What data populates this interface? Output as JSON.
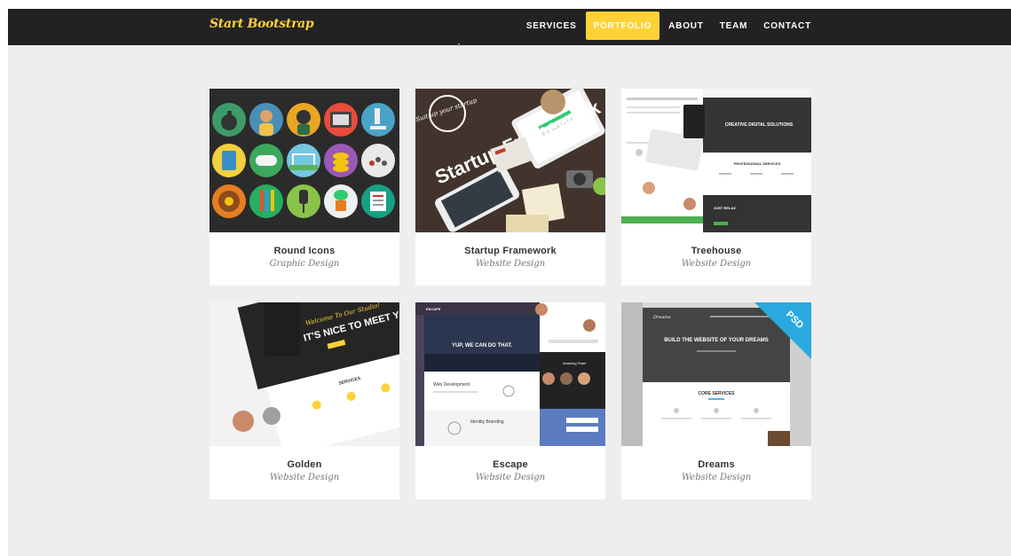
{
  "brand": "Start Bootstrap",
  "nav": {
    "items": [
      "Services",
      "Portfolio",
      "About",
      "Team",
      "Contact"
    ],
    "active": "Portfolio"
  },
  "portfolio": {
    "items": [
      {
        "title": "Round Icons",
        "category": "Graphic Design"
      },
      {
        "title": "Startup Framework",
        "category": "Website Design"
      },
      {
        "title": "Treehouse",
        "category": "Website Design"
      },
      {
        "title": "Golden",
        "category": "Website Design"
      },
      {
        "title": "Escape",
        "category": "Website Design"
      },
      {
        "title": "Dreams",
        "category": "Website Design"
      }
    ]
  },
  "thumbs": {
    "startup": {
      "badge": "Suit up your startup",
      "headline": "Startup Framework"
    },
    "treehouse": {
      "hero": "CREATIVE DIGITAL SOLUTIONS",
      "services": "PROFESSIONAL SERVICES",
      "cta": "JUST RELAX"
    },
    "golden": {
      "welcome": "Welcome To Our Studio!",
      "headline": "IT'S NICE TO MEET YOU",
      "services": "SERVICES"
    },
    "escape": {
      "brand": "ESCAPE",
      "headline": "YUP, WE CAN DO THAT.",
      "team": "Amazing Team",
      "web": "Web Development",
      "identity": "Identity Branding"
    },
    "dreams": {
      "brand": "Dreams",
      "headline": "BUILD THE WEBSITE OF YOUR DREAMS",
      "services": "CORE SERVICES",
      "ribbon": "PSD"
    }
  },
  "colors": {
    "navbar": "#222222",
    "accent": "#fed136",
    "background": "#eeeeee"
  }
}
